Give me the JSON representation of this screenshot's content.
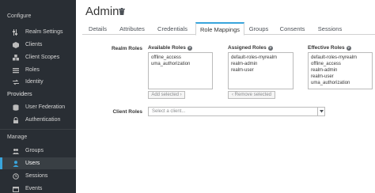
{
  "sidebar": {
    "configure_label": "Configure",
    "configure_items": [
      {
        "label": "Realm Settings",
        "icon": "sliders-icon"
      },
      {
        "label": "Clients",
        "icon": "cube-icon"
      },
      {
        "label": "Client Scopes",
        "icon": "cubes-icon"
      },
      {
        "label": "Roles",
        "icon": "list-icon"
      },
      {
        "label": "Identity",
        "icon": "exchange-icon"
      }
    ],
    "providers_label": "Providers",
    "provider_items": [
      {
        "label": "User Federation",
        "icon": "database-icon"
      },
      {
        "label": "Authentication",
        "icon": "lock-icon"
      }
    ],
    "manage_label": "Manage",
    "manage_items": [
      {
        "label": "Groups",
        "icon": "users-icon"
      },
      {
        "label": "Users",
        "icon": "user-icon"
      },
      {
        "label": "Sessions",
        "icon": "clock-icon"
      },
      {
        "label": "Events",
        "icon": "calendar-icon"
      }
    ]
  },
  "header": {
    "title": "Admin"
  },
  "tabs": [
    "Details",
    "Attributes",
    "Credentials",
    "Role Mappings",
    "Groups",
    "Consents",
    "Sessions"
  ],
  "active_tab": "Role Mappings",
  "realm_roles": {
    "label": "Realm Roles",
    "available": {
      "title": "Available Roles",
      "items": [
        "offline_access",
        "uma_authorization"
      ],
      "button": "Add selected ›"
    },
    "assigned": {
      "title": "Assigned Roles",
      "items": [
        "default-roles-myrealm",
        "realm-admin",
        "realm-user"
      ],
      "button": "‹ Remove selected"
    },
    "effective": {
      "title": "Effective Roles",
      "items": [
        "default-roles-myrealm",
        "offline_access",
        "realm-admin",
        "realm-user",
        "uma_authorization"
      ]
    }
  },
  "client_roles": {
    "label": "Client Roles",
    "placeholder": "Select a client..."
  },
  "colors": {
    "sidebar_bg": "#292e34",
    "accent": "#39a5dc"
  }
}
